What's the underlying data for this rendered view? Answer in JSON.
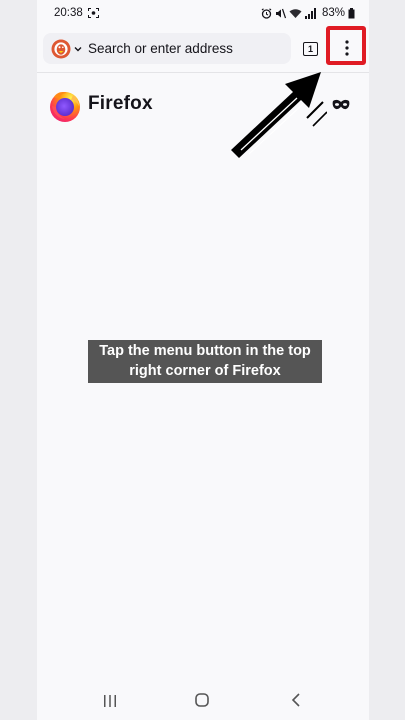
{
  "status_bar": {
    "time": "20:38",
    "battery": "83%"
  },
  "toolbar": {
    "url_placeholder": "Search or enter address",
    "tab_count": "1"
  },
  "brand": {
    "name": "Firefox"
  },
  "caption": {
    "text": "Tap the menu button in the top right corner of Firefox"
  },
  "colors": {
    "highlight": "#e01b24",
    "caption_bg": "#555555",
    "page_bg": "#f9f9fb"
  },
  "icons": [
    "screenshot-icon",
    "alarm-icon",
    "mute-icon",
    "wifi-icon",
    "signal-icon",
    "battery-icon",
    "duckduckgo-icon",
    "chevron-down-icon",
    "tabs-icon",
    "menu-icon",
    "firefox-logo",
    "private-mask-icon",
    "arrow-icon",
    "recents-icon",
    "home-icon",
    "back-icon"
  ]
}
